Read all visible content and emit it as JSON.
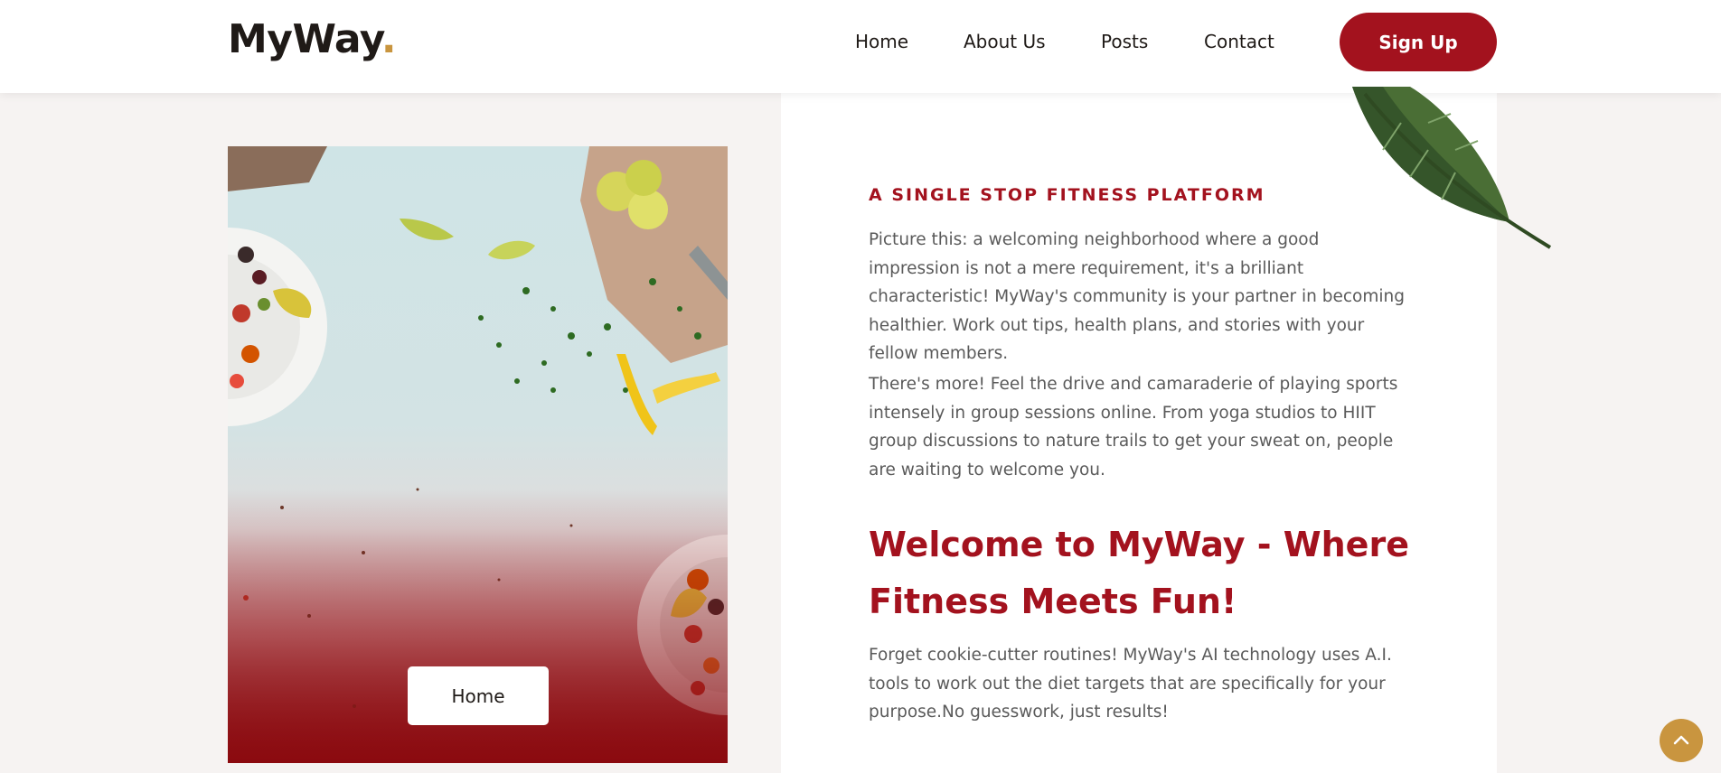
{
  "brand": {
    "name": "MyWay",
    "dot": ".",
    "dot_color": "#c9953f"
  },
  "nav": {
    "items": [
      {
        "label": "Home"
      },
      {
        "label": "About Us"
      },
      {
        "label": "Posts"
      },
      {
        "label": "Contact"
      }
    ],
    "signup_label": "Sign Up"
  },
  "hero_image": {
    "button_label": "Home",
    "icon": "salad-photo"
  },
  "content": {
    "kicker": "A SINGLE STOP FITNESS PLATFORM",
    "paragraph1": "Picture this: a welcoming neighborhood where a good impression is not a mere requirement, it's a brilliant characteristic! MyWay's community is your partner in becoming healthier. Work out tips, health plans, and stories with your fellow members.",
    "paragraph2": "There's more! Feel the drive and camaraderie of playing sports intensely in group sessions online. From yoga studios to HIIT group discussions to nature trails to get your sweat on, people are waiting to welcome you.",
    "heading": "Welcome to MyWay - Where Fitness Meets Fun!",
    "paragraph3": "Forget cookie-cutter routines! MyWay's AI technology uses A.I. tools to work out the diet targets that are specifically for your purpose.No guesswork, just results!"
  },
  "colors": {
    "accent": "#a3121e",
    "gold": "#c9953f",
    "background": "#f6f3f2"
  },
  "icons": {
    "leaf": "leaf-icon",
    "scroll_top": "chevron-up-icon"
  }
}
